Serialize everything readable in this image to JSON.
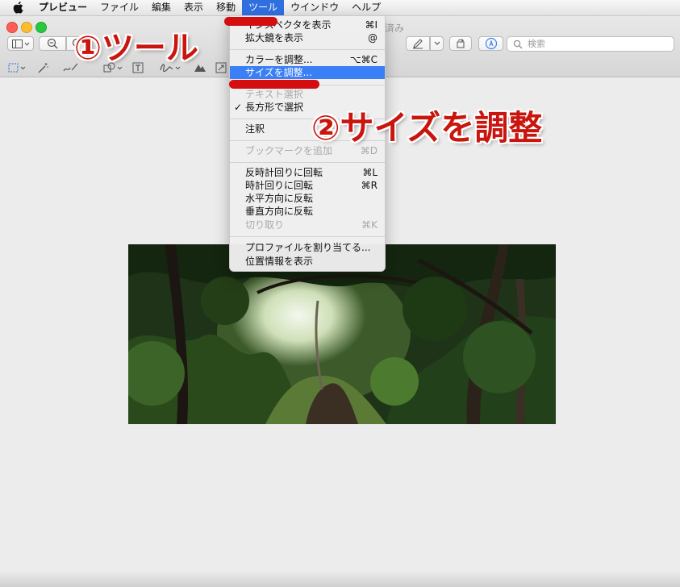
{
  "menubar": {
    "app_name": "プレビュー",
    "items": [
      "ファイル",
      "編集",
      "表示",
      "移動",
      "ツール",
      "ウインドウ",
      "ヘルプ"
    ]
  },
  "window": {
    "title_fragment": "済み",
    "search_placeholder": "検索"
  },
  "tools_menu": {
    "items": [
      {
        "label": "インスペクタを表示",
        "shortcut": "⌘I",
        "enabled": true
      },
      {
        "label": "拡大鏡を表示",
        "shortcut": "@",
        "enabled": true
      },
      {
        "label": "カラーを調整...",
        "shortcut": "⌥⌘C",
        "enabled": true
      },
      {
        "label": "サイズを調整...",
        "shortcut": "",
        "enabled": true,
        "highlighted": true
      },
      {
        "label": "テキスト選択",
        "shortcut": "",
        "enabled": false
      },
      {
        "label": "長方形で選択",
        "shortcut": "",
        "enabled": true,
        "checked": true
      },
      {
        "label": "注釈",
        "shortcut": "",
        "enabled": true
      },
      {
        "label": "ブックマークを追加",
        "shortcut": "⌘D",
        "enabled": false
      },
      {
        "label": "反時計回りに回転",
        "shortcut": "⌘L",
        "enabled": true
      },
      {
        "label": "時計回りに回転",
        "shortcut": "⌘R",
        "enabled": true
      },
      {
        "label": "水平方向に反転",
        "shortcut": "",
        "enabled": true
      },
      {
        "label": "垂直方向に反転",
        "shortcut": "",
        "enabled": true
      },
      {
        "label": "切り取り",
        "shortcut": "⌘K",
        "enabled": false
      },
      {
        "label": "プロファイルを割り当てる...",
        "shortcut": "",
        "enabled": true
      },
      {
        "label": "位置情報を表示",
        "shortcut": "",
        "enabled": true
      }
    ]
  },
  "annotations": {
    "step1": "①ツール",
    "step2": "②サイズを調整"
  },
  "colors": {
    "accent": "#3a7ff6",
    "annotation_red": "#c9150d"
  }
}
